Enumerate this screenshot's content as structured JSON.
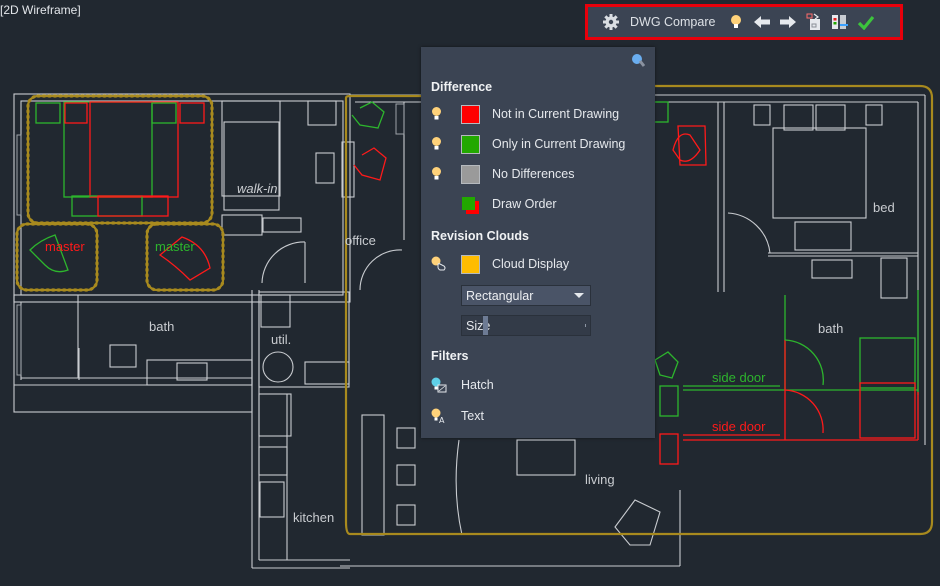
{
  "viewport": {
    "view_label": "[2D Wireframe]",
    "room_labels": {
      "walk_in": "walk-in",
      "office": "office",
      "bed": "bed",
      "bath_left": "bath",
      "util": "util.",
      "bath_right": "bath",
      "kitchen": "kitchen",
      "living": "living",
      "master_old": "master",
      "master_new": "master",
      "side_door_new": "side door",
      "side_door_old": "side door"
    }
  },
  "toolbar": {
    "settings_icon": "gear-icon",
    "title": "DWG Compare",
    "toggle_icon": "lightbulb-icon",
    "previous_icon": "arrow-left-icon",
    "next_icon": "arrow-right-icon",
    "snapshot_icon": "import-objects-icon",
    "export_icon": "export-snapshot-icon",
    "done_icon": "checkmark-icon"
  },
  "panel": {
    "pin_icon": "pin-icon",
    "difference": {
      "title": "Difference",
      "items": [
        {
          "label": "Not in Current Drawing",
          "color": "#ff0000",
          "icon": "lightbulb-icon"
        },
        {
          "label": "Only in Current Drawing",
          "color": "#22a800",
          "icon": "lightbulb-icon"
        },
        {
          "label": "No Differences",
          "color": "#9a9a9a",
          "icon": "lightbulb-icon"
        },
        {
          "label": "Draw Order",
          "icon": "draw-order-icon"
        }
      ]
    },
    "revision_clouds": {
      "title": "Revision Clouds",
      "cloud_display_label": "Cloud Display",
      "cloud_color": "#ffbc00",
      "shape_selected": "Rectangular",
      "size_label": "Size"
    },
    "filters": {
      "title": "Filters",
      "items": [
        {
          "label": "Hatch",
          "icon": "hatch-filter-icon"
        },
        {
          "label": "Text",
          "icon": "text-filter-icon"
        }
      ]
    }
  },
  "colors": {
    "background": "#212830",
    "panel": "#3b4453",
    "highlight_border": "#e8000b",
    "cloud": "#a88a1e",
    "old": "#ff1a1a",
    "new": "#2db52d"
  }
}
